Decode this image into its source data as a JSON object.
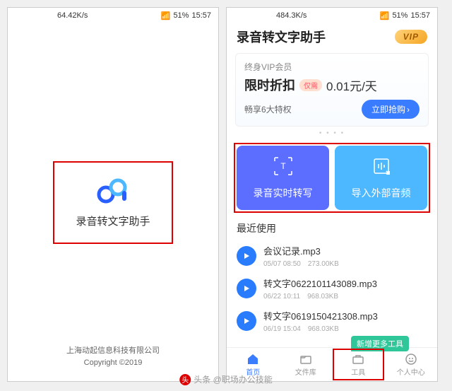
{
  "status": {
    "speed1": "64.42K/s",
    "speed2": "484.3K/s",
    "battery": "51%",
    "time": "15:57"
  },
  "splash": {
    "title": "录音转文字助手",
    "company": "上海动起信息科技有限公司",
    "copyright": "Copyright ©2019"
  },
  "main": {
    "title": "录音转文字助手",
    "vip_badge": "VIP",
    "vip": {
      "member": "终身VIP会员",
      "discount": "限时折扣",
      "only": "仅需",
      "price": "0.01元/天",
      "perks": "畅享6大特权",
      "buy": "立即抢购"
    },
    "actions": {
      "record": "录音实时转写",
      "import": "导入外部音频"
    },
    "recent_title": "最近使用",
    "files": [
      {
        "name": "会议记录.mp3",
        "meta": "05/07 08:50　273.00KB"
      },
      {
        "name": "转文字0622101143089.mp3",
        "meta": "06/22 10:11　968.03KB"
      },
      {
        "name": "转文字0619150421308.mp3",
        "meta": "06/19 15:04　968.03KB"
      }
    ],
    "more_tools": "新增更多工具",
    "tabs": {
      "home": "首页",
      "files": "文件库",
      "tools": "工具",
      "profile": "个人中心"
    }
  },
  "watermark": "头条 @职场办公技能"
}
